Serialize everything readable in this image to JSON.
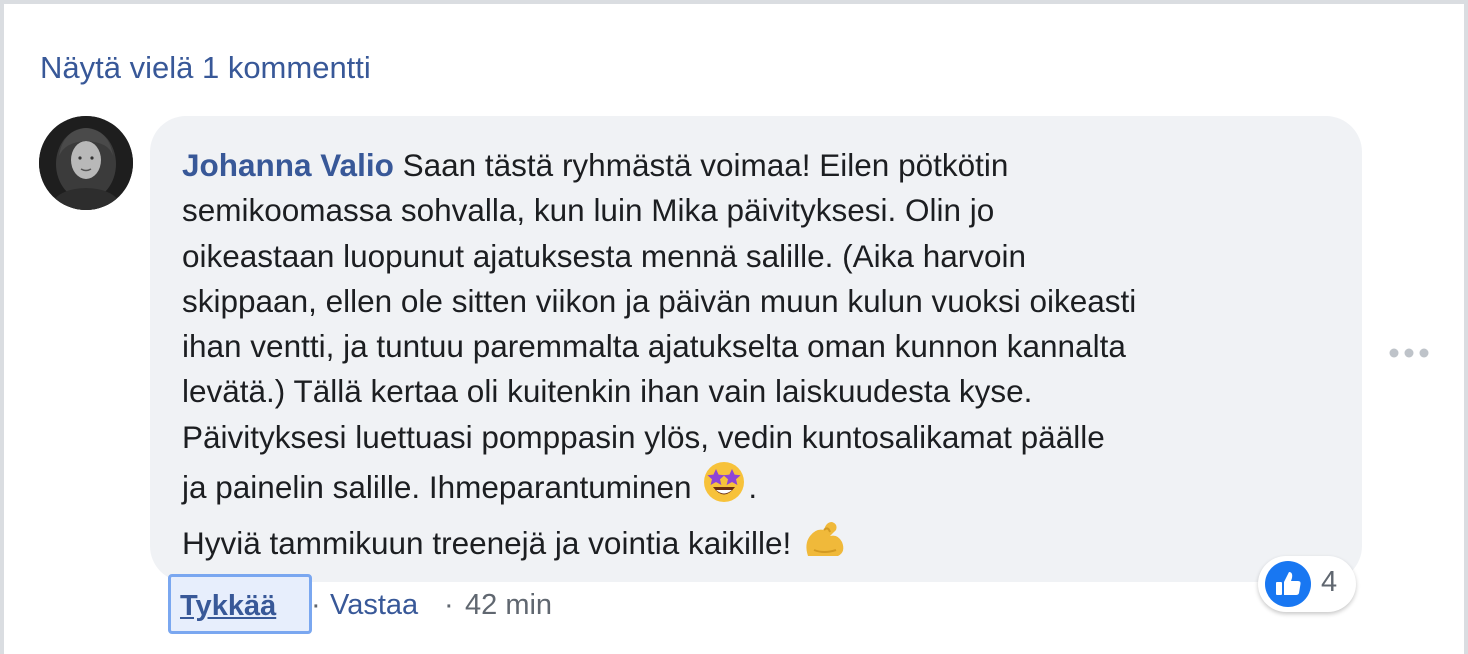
{
  "more_comments_label": "Näytä vielä 1 kommentti",
  "comment": {
    "author": "Johanna Valio",
    "lines": [
      "Saan tästä ryhmästä voimaa! Eilen pötkötin",
      "semikoomassa sohvalla, kun luin Mika päivityksesi. Olin jo",
      "oikeastaan luopunut ajatuksesta mennä salille. (Aika harvoin",
      "skippaan, ellen ole sitten viikon ja päivän muun kulun vuoksi oikeasti",
      "ihan ventti, ja tuntuu paremmalta ajatukselta oman kunnon kannalta",
      "levätä.) Tällä kertaa oli kuitenkin ihan vain laiskuudesta kyse.",
      "Päivityksesi luettuasi pomppasin ylös, vedin kuntosalikamat päälle",
      "ja painelin salille. Ihmeparantuminen",
      ".",
      "Hyviä tammikuun treenejä ja vointia kaikille!"
    ],
    "emoji_1": "star-struck-emoji",
    "emoji_2": "flexed-biceps-emoji"
  },
  "reactions": {
    "icon": "thumbs-up-icon",
    "count": "4"
  },
  "actions": {
    "like": "Tykkää",
    "separator": "·",
    "reply": "Vastaa",
    "time": "42 min"
  },
  "colors": {
    "link_blue": "#385898",
    "bubble_bg": "#f0f2f5",
    "like_blue": "#1877f2",
    "meta_gray": "#606770"
  }
}
